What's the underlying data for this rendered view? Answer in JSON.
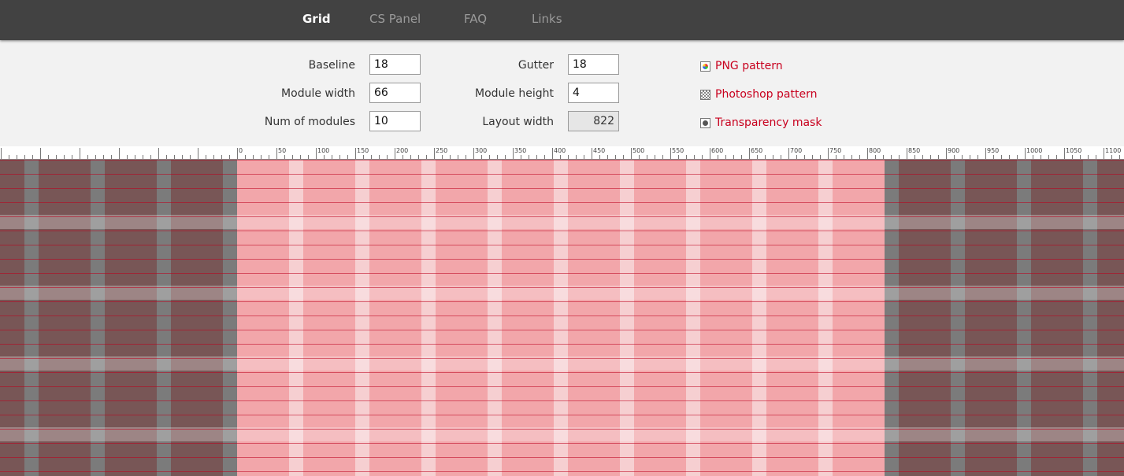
{
  "nav": {
    "items": [
      {
        "label": "Grid",
        "active": true
      },
      {
        "label": "CS Panel",
        "active": false
      },
      {
        "label": "FAQ",
        "active": false
      },
      {
        "label": "Links",
        "active": false
      }
    ]
  },
  "settings": {
    "baseline": {
      "label": "Baseline",
      "value": "18"
    },
    "module_width": {
      "label": "Module width",
      "value": "66"
    },
    "num_modules": {
      "label": "Num of modules",
      "value": "10"
    },
    "gutter": {
      "label": "Gutter",
      "value": "18"
    },
    "module_height": {
      "label": "Module height",
      "value": "4"
    },
    "layout_width": {
      "label": "Layout width",
      "value": "822"
    }
  },
  "downloads": {
    "png": {
      "label": "PNG pattern",
      "icon": "png-icon"
    },
    "photoshop": {
      "label": "Photoshop pattern",
      "icon": "checker-pattern-icon"
    },
    "mask": {
      "label": "Transparency mask",
      "icon": "mask-icon"
    }
  },
  "ruler": {
    "labels": [
      "0",
      "50",
      "100",
      "150",
      "200",
      "250",
      "300",
      "350",
      "400",
      "450",
      "500",
      "550",
      "600",
      "650",
      "700",
      "750",
      "800",
      "850",
      "900",
      "950",
      "1000",
      "1050",
      "1100"
    ]
  },
  "colors": {
    "link": "#c8001e",
    "module_inside": "#f2a6aa",
    "gutter_inside": "#f6cfd1",
    "module_outside": "#785656",
    "gutter_outside": "#7b7b7b"
  }
}
